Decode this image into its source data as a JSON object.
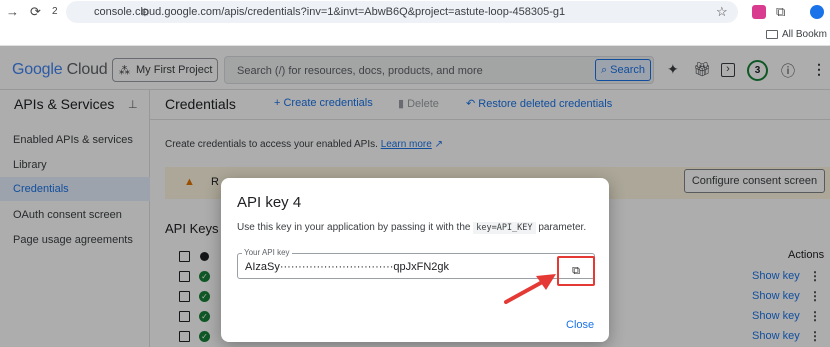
{
  "browser": {
    "url": "console.cloud.google.com/apis/credentials?inv=1&invt=AbwB6Q&project=astute-loop-458305-g1",
    "tab_count": "2",
    "bookmarks_label": "All Bookm"
  },
  "topbar": {
    "logo_google": "Google",
    "logo_cloud": "Cloud",
    "project": "My First Project",
    "search_placeholder": "Search (/) for resources, docs, products, and more",
    "search_button": "Search",
    "notifications_count": "3"
  },
  "sidebar": {
    "title": "APIs & Services",
    "items": [
      {
        "label": "Enabled APIs & services"
      },
      {
        "label": "Library"
      },
      {
        "label": "Credentials"
      },
      {
        "label": "OAuth consent screen"
      },
      {
        "label": "Page usage agreements"
      }
    ]
  },
  "main": {
    "title": "Credentials",
    "create_label": "+ Create credentials",
    "delete_label": "Delete",
    "restore_label": "Restore deleted credentials",
    "info_text": "Create credentials to access your enabled APIs.",
    "learn_more": "Learn more",
    "warning_prefix": "R",
    "consent_button": "Configure consent screen",
    "api_keys_title": "API Keys",
    "actions_header": "Actions",
    "show_key_label": "Show key"
  },
  "modal": {
    "title": "API key 4",
    "desc_before": "Use this key in your application by passing it with the",
    "desc_code": "key=API_KEY",
    "desc_after": "parameter.",
    "field_label": "Your API key",
    "key_value": "AIzaSy·······························qpJxFN2gk",
    "close_label": "Close"
  },
  "colors": {
    "accent": "#1a73e8",
    "highlight": "#e53935",
    "success": "#188038"
  }
}
